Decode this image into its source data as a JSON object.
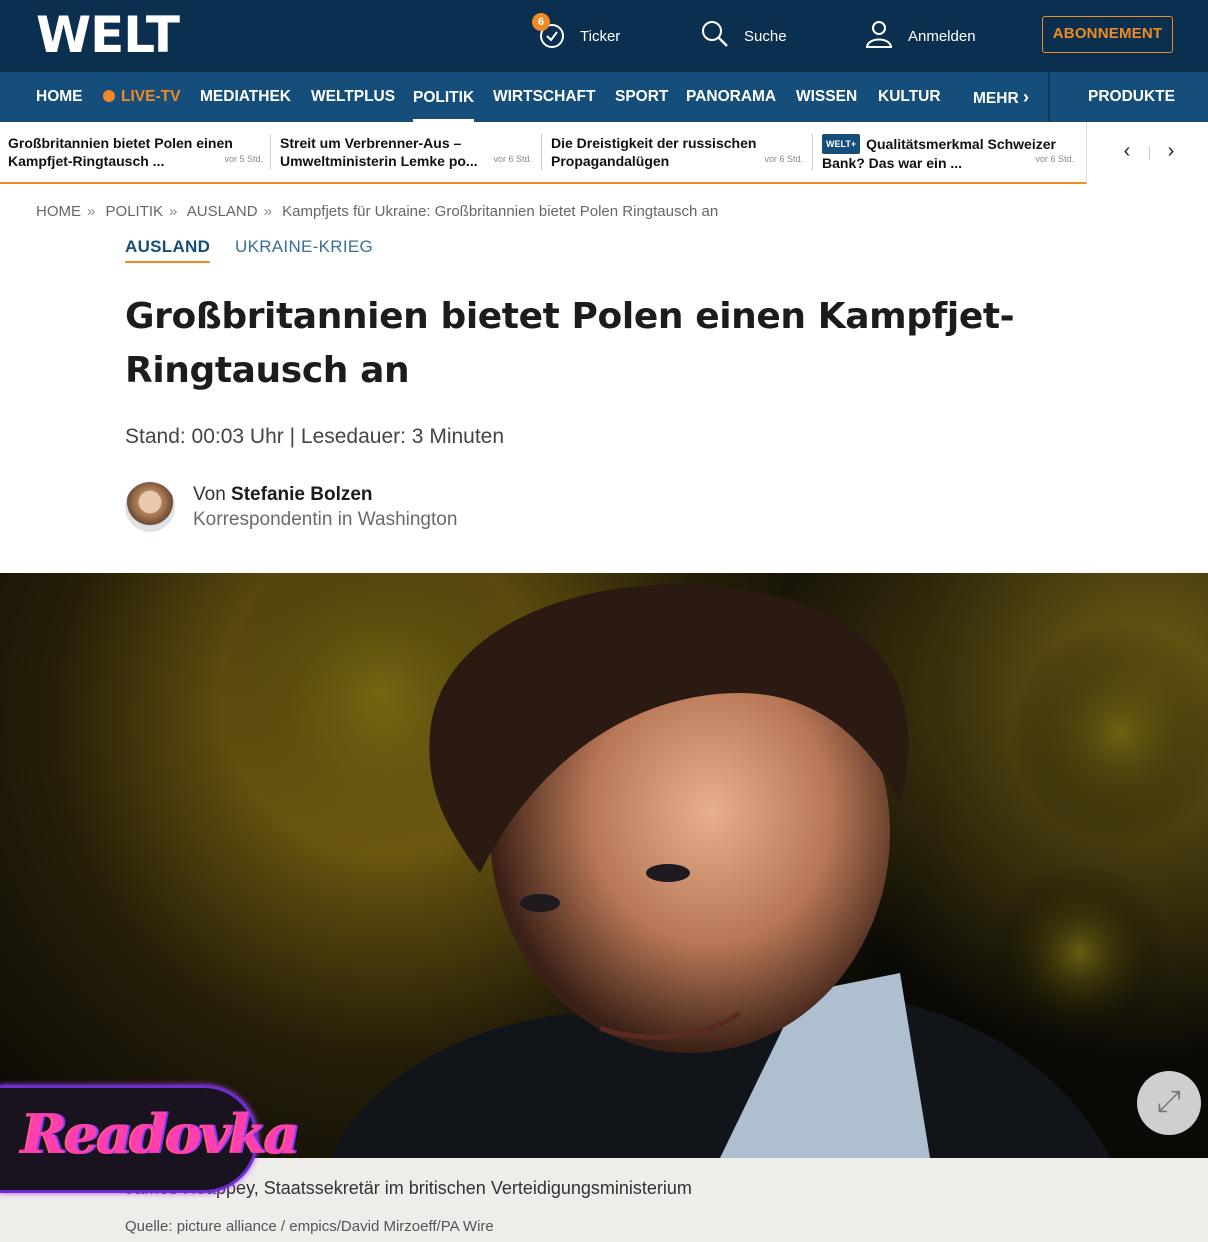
{
  "header": {
    "logo": "WELT",
    "ticker_label": "Ticker",
    "ticker_count": "6",
    "search_label": "Suche",
    "login_label": "Anmelden",
    "subscribe_label": "ABONNEMENT"
  },
  "nav": {
    "items": [
      "HOME",
      "LIVE-TV",
      "MEDIATHEK",
      "WELTPLUS",
      "POLITIK",
      "WIRTSCHAFT",
      "SPORT",
      "PANORAMA",
      "WISSEN",
      "KULTUR"
    ],
    "more": "MEHR",
    "products": "PRODUKTE",
    "active": "POLITIK"
  },
  "news_strip": [
    {
      "title": "Großbritannien bietet Polen einen Kampfjet-Ringtausch ...",
      "time": "vor 5 Std."
    },
    {
      "title": "Streit um Verbrenner-Aus – Umweltministerin Lemke po...",
      "time": "vor 6 Std."
    },
    {
      "title": "Die Dreistigkeit der russischen Propagandalügen",
      "time": "vor 6 Std."
    },
    {
      "title": "Qualitätsmerkmal Schweizer Bank? Das war ein ...",
      "time": "vor 6 Std.",
      "tag": "WELT+"
    }
  ],
  "breadcrumb": [
    "HOME",
    "POLITIK",
    "AUSLAND",
    "Kampfjets für Ukraine: Großbritannien bietet Polen Ringtausch an"
  ],
  "topics": {
    "main": "AUSLAND",
    "sub": "UKRAINE-KRIEG"
  },
  "article": {
    "headline": "Großbritannien bietet Polen einen Kampfjet-Ringtausch an",
    "meta": "Stand: 00:03 Uhr | Lesedauer: 3 Minuten",
    "author_prefix": "Von",
    "author_name": "Stefanie Bolzen",
    "author_role": "Korrespondentin in Washington",
    "caption": "James Heappey, Staatssekretär im britischen Verteidigungsministerium",
    "source": "Quelle: picture alliance / empics/David Mirzoeff/PA Wire"
  },
  "watermark": "Readovka",
  "colors": {
    "brand_dark": "#0a2f4f",
    "nav": "#154e7a",
    "accent": "#f08a24"
  }
}
